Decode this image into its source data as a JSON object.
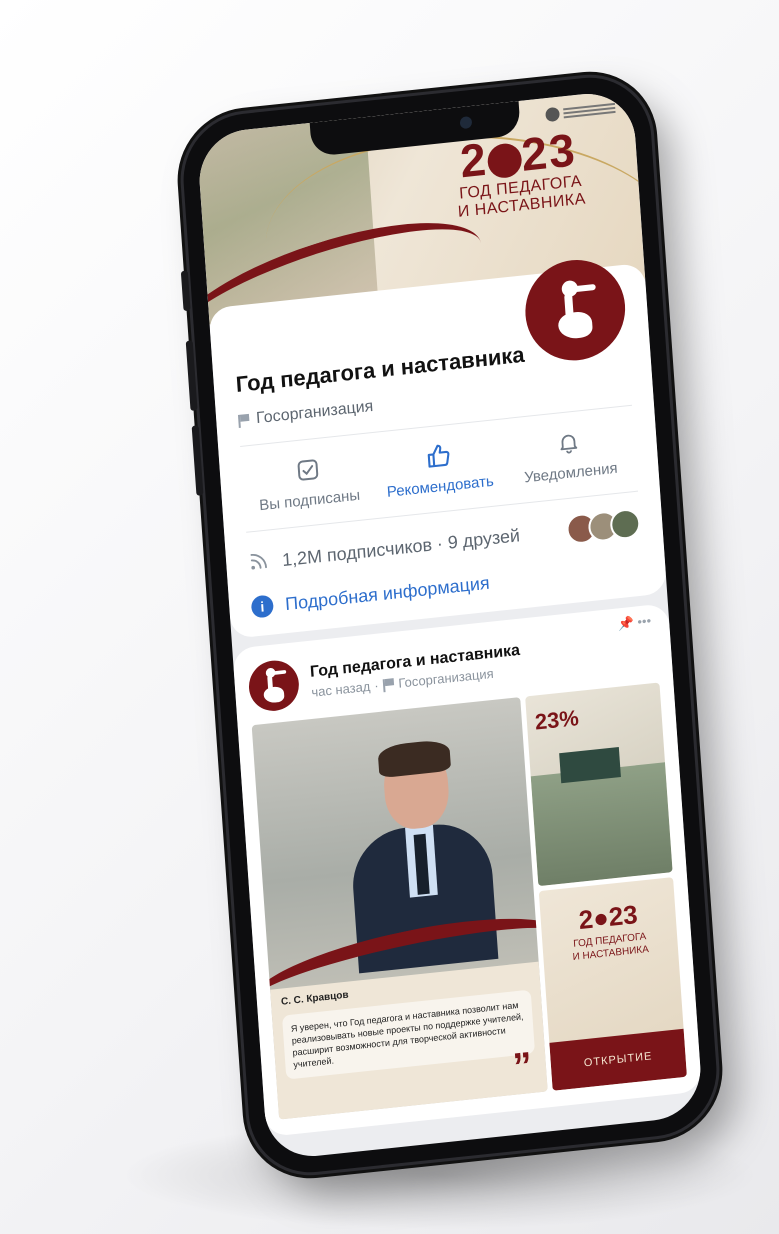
{
  "header": {
    "crest_text": "",
    "cover_logo": {
      "year_left": "2",
      "year_right": "23",
      "line1": "ГОД ПЕДАГОГА",
      "line2": "И НАСТАВНИКА"
    }
  },
  "profile": {
    "name": "Год педагога и наставника",
    "type": "Госорганизация"
  },
  "actions": [
    {
      "label": "Вы подписаны",
      "icon": "checkbox-icon"
    },
    {
      "label": "Рекомендовать",
      "icon": "thumbs-up-icon"
    },
    {
      "label": "Уведомления",
      "icon": "bell-icon"
    }
  ],
  "stats": {
    "subscribers": "1,2M подписчиков · 9 друзей"
  },
  "info_link": "Подробная информация",
  "post": {
    "author": "Год педагога и наставника",
    "time": "час назад",
    "type": "Госорганизация",
    "percent": "23%",
    "speaker": "С. С. Кравцов",
    "quote": "Я уверен, что Год педагога и наставника позволит нам реализовывать новые проекты по поддержке учителей, расширит возможности для творческой активности учителей.",
    "logo_year_left": "2",
    "logo_year_right": "23",
    "logo_line1": "ГОД ПЕДАГОГА",
    "logo_line2": "И НАСТАВНИКА",
    "open_label": "ОТКРЫТИЕ"
  },
  "colors": {
    "brand": "#7a1418",
    "accent": "#2d6ecc",
    "muted": "#6f7985"
  }
}
